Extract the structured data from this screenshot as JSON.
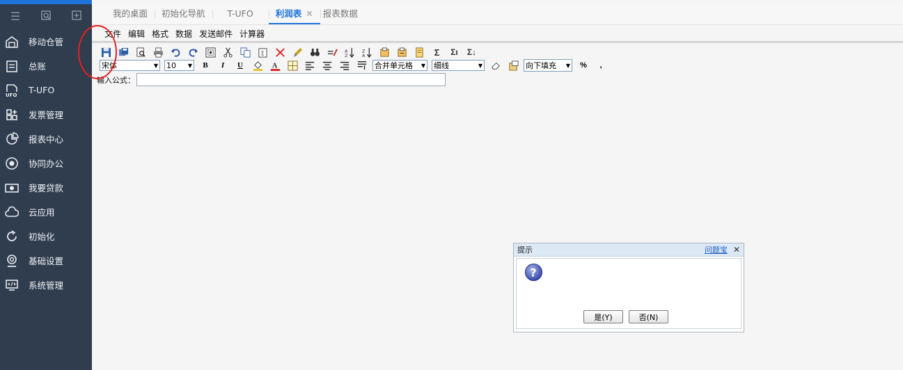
{
  "sidebar": {
    "top_icons": [
      "menu-icon",
      "search-doc-icon",
      "add-doc-icon"
    ],
    "items": [
      {
        "label": "移动仓管",
        "icon": "warehouse-icon"
      },
      {
        "label": "总账",
        "icon": "ledger-icon"
      },
      {
        "label": "T-UFO",
        "icon": "ufo-report-icon"
      },
      {
        "label": "发票管理",
        "icon": "invoice-icon"
      },
      {
        "label": "报表中心",
        "icon": "pie-chart-icon"
      },
      {
        "label": "协同办公",
        "icon": "collaboration-icon"
      },
      {
        "label": "我要贷款",
        "icon": "money-icon"
      },
      {
        "label": "云应用",
        "icon": "cloud-icon"
      },
      {
        "label": "初始化",
        "icon": "refresh-icon"
      },
      {
        "label": "基础设置",
        "icon": "webcam-settings-icon"
      },
      {
        "label": "系统管理",
        "icon": "code-monitor-icon"
      }
    ]
  },
  "tabs": [
    {
      "label": "我的桌面",
      "active": false
    },
    {
      "label": "初始化导航",
      "active": false
    },
    {
      "label": "T-UFO",
      "active": false
    },
    {
      "label": "利润表",
      "active": true,
      "close": "✕"
    },
    {
      "label": "报表数据",
      "active": false
    }
  ],
  "menu": [
    "文件",
    "编辑",
    "格式",
    "数据",
    "发送邮件",
    "计算器"
  ],
  "toolbar": {
    "font_value": "宋体",
    "size_value": "10",
    "bold": "B",
    "italic": "I",
    "underline": "U",
    "merge_value": "合并单元格",
    "border_value": "细线",
    "fill_value": "向下填充",
    "percent": "%",
    "comma": ","
  },
  "formula": {
    "label": "输入公式：",
    "value": ""
  },
  "dialog": {
    "title": "提示",
    "help_link": "问题宝",
    "close": "✕",
    "message": "",
    "yes_label": "是(Y)",
    "no_label": "否(N)"
  },
  "colors": {
    "sidebar": "#2f3d4e",
    "accent": "#1e73d8",
    "annotation": "#e82020"
  }
}
